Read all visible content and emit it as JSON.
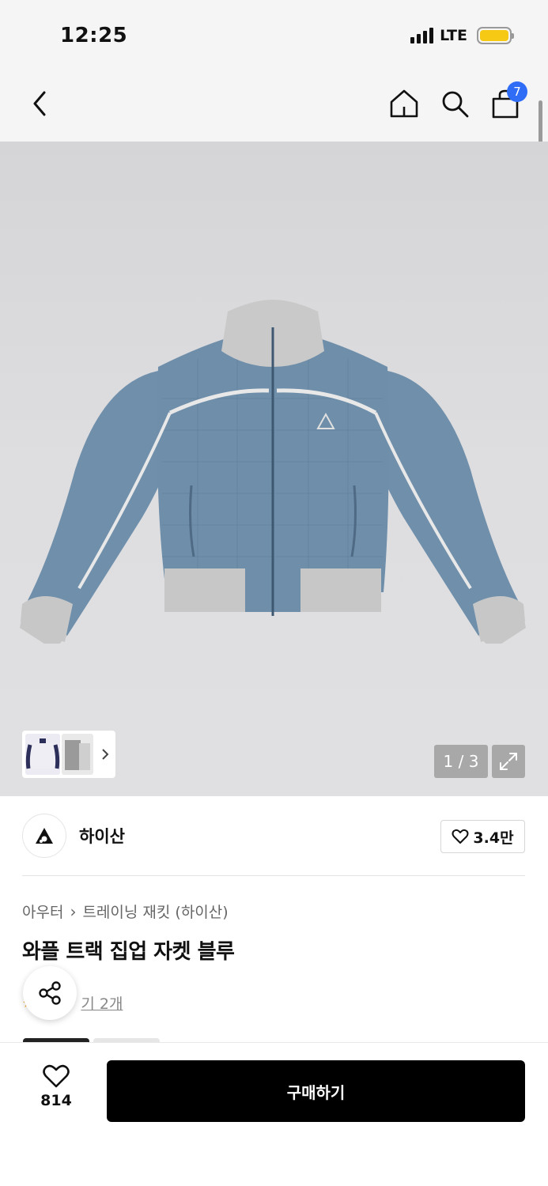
{
  "status_bar": {
    "time": "12:25",
    "network": "LTE"
  },
  "nav": {
    "cart_count": "7"
  },
  "gallery": {
    "page_counter": "1 / 3",
    "current_page": 1,
    "total_pages": 3
  },
  "brand": {
    "name": "하이산",
    "likes": "3.4만"
  },
  "breadcrumb": {
    "category": "아우터",
    "subcategory": "트레이닝 재킷 (하이산)"
  },
  "product": {
    "title": "와플 트랙 집업 자켓 블루"
  },
  "reviews": {
    "label": "후기 2개",
    "visible_label": "기 2개"
  },
  "bottom_bar": {
    "wish_count": "814",
    "buy_label": "구매하기"
  },
  "colors": {
    "accent_badge": "#2f6df6",
    "battery": "#f6c915",
    "buy_button": "#000000",
    "jacket_body": "#6f8fab",
    "jacket_trim": "#c9c9c9"
  }
}
